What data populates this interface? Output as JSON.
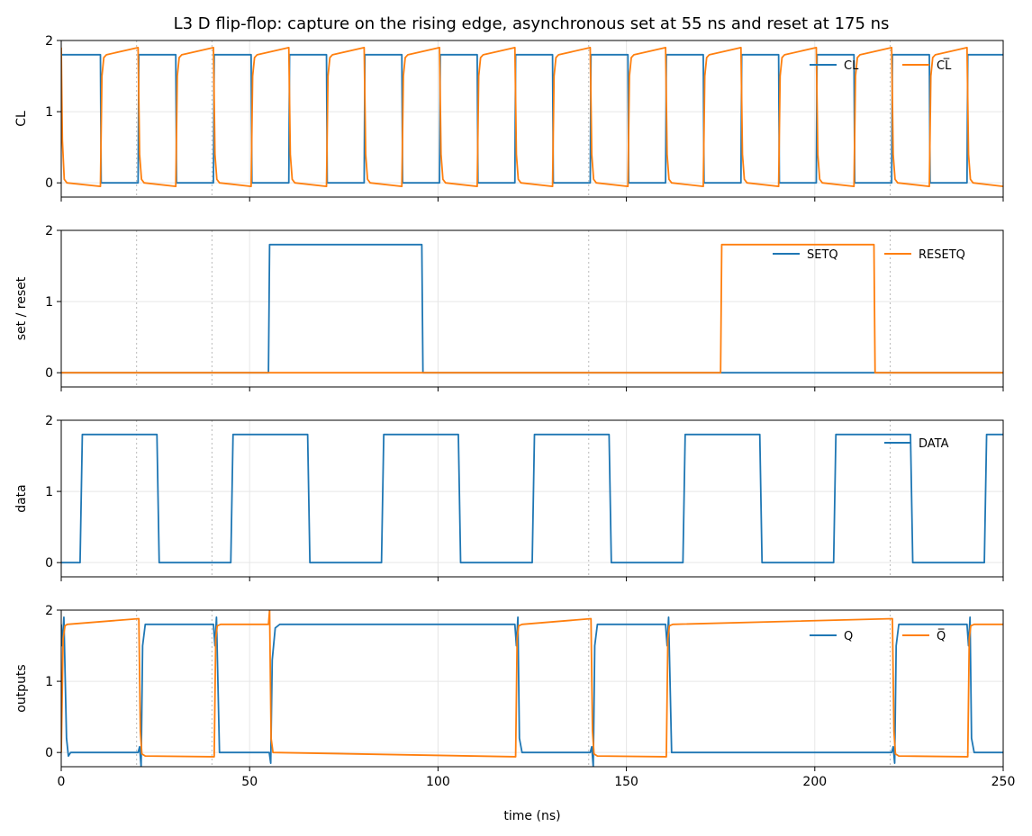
{
  "chart_data": {
    "type": "line",
    "title": "L3  D flip-flop: capture on the rising edge, asynchronous set at 55 ns and reset at 175 ns",
    "xlabel": "time (ns)",
    "xlim": [
      0,
      250
    ],
    "x_ticks": [
      0,
      50,
      100,
      150,
      200,
      250
    ],
    "x_tick_labels": [
      "0",
      "50",
      "100",
      "150",
      "200",
      "250"
    ],
    "dotted_markers_ns": [
      20,
      40,
      140,
      220
    ],
    "colors": {
      "blue": "#1f77b4",
      "orange": "#ff7f0e"
    },
    "panels": [
      {
        "ylabel": "CL",
        "ylim": [
          -0.2,
          2
        ],
        "y_ticks": [
          0,
          1,
          2
        ],
        "y_tick_labels": [
          "0",
          "1",
          "2"
        ],
        "legend_position": "top-right",
        "series": [
          {
            "name": "CL",
            "color": "#1f77b4",
            "x": [
              0,
              0.4,
              10.4,
              10.6,
              20.4,
              20.6,
              30.4,
              30.6,
              40.4,
              40.6,
              50.4,
              50.6,
              60.4,
              60.6,
              70.4,
              70.6,
              80.4,
              80.6,
              90.4,
              90.6,
              100.4,
              100.6,
              110.4,
              110.6,
              120.4,
              120.6,
              130.4,
              130.6,
              140.4,
              140.6,
              150.4,
              150.6,
              160.4,
              160.6,
              170.4,
              170.6,
              180.4,
              180.6,
              190.4,
              190.6,
              200.4,
              200.6,
              210.4,
              210.6,
              220.4,
              220.6,
              230.4,
              230.6,
              240.4,
              240.6,
              250
            ],
            "y": [
              1.8,
              1.8,
              1.8,
              0,
              0,
              1.8,
              1.8,
              0,
              0,
              1.8,
              1.8,
              0,
              0,
              1.8,
              1.8,
              0,
              0,
              1.8,
              1.8,
              0,
              0,
              1.8,
              1.8,
              0,
              0,
              1.8,
              1.8,
              0,
              0,
              1.8,
              1.8,
              0,
              0,
              1.8,
              1.8,
              0,
              0,
              1.8,
              1.8,
              0,
              0,
              1.8,
              1.8,
              0,
              0,
              1.8,
              1.8,
              0,
              0,
              1.8,
              1.8
            ]
          },
          {
            "name": "CL̅",
            "color": "#ff7f0e",
            "x": [
              0,
              0.3,
              0.8,
              1.5,
              10.4,
              10.8,
              11.3,
              12,
              20.4,
              20.8,
              21.3,
              22,
              30.4,
              30.8,
              31.3,
              32,
              40.4,
              40.8,
              41.3,
              42,
              50.4,
              50.8,
              51.3,
              52,
              60.4,
              60.8,
              61.3,
              62,
              70.4,
              70.8,
              71.3,
              72,
              80.4,
              80.8,
              81.3,
              82,
              90.4,
              90.8,
              91.3,
              92,
              100.4,
              100.8,
              101.3,
              102,
              110.4,
              110.8,
              111.3,
              112,
              120.4,
              120.8,
              121.3,
              122,
              130.4,
              130.8,
              131.3,
              132,
              140.4,
              140.8,
              141.3,
              142,
              150.4,
              150.8,
              151.3,
              152,
              160.4,
              160.8,
              161.3,
              162,
              170.4,
              170.8,
              171.3,
              172,
              180.4,
              180.8,
              181.3,
              182,
              190.4,
              190.8,
              191.3,
              192,
              200.4,
              200.8,
              201.3,
              202,
              210.4,
              210.8,
              211.3,
              212,
              220.4,
              220.8,
              221.3,
              222,
              230.4,
              230.8,
              231.3,
              232,
              240.4,
              240.8,
              241.3,
              242,
              250
            ],
            "y": [
              1.9,
              0.6,
              0.05,
              0,
              -0.05,
              1.5,
              1.76,
              1.8,
              1.9,
              0.4,
              0.05,
              0,
              -0.05,
              1.5,
              1.76,
              1.8,
              1.9,
              0.4,
              0.05,
              0,
              -0.05,
              1.5,
              1.76,
              1.8,
              1.9,
              0.4,
              0.05,
              0,
              -0.05,
              1.5,
              1.76,
              1.8,
              1.9,
              0.4,
              0.05,
              0,
              -0.05,
              1.5,
              1.76,
              1.8,
              1.9,
              0.4,
              0.05,
              0,
              -0.05,
              1.5,
              1.76,
              1.8,
              1.9,
              0.4,
              0.05,
              0,
              -0.05,
              1.5,
              1.76,
              1.8,
              1.9,
              0.4,
              0.05,
              0,
              -0.05,
              1.5,
              1.76,
              1.8,
              1.9,
              0.4,
              0.05,
              0,
              -0.05,
              1.5,
              1.76,
              1.8,
              1.9,
              0.4,
              0.05,
              0,
              -0.05,
              1.5,
              1.76,
              1.8,
              1.9,
              0.4,
              0.05,
              0,
              -0.05,
              1.5,
              1.76,
              1.8,
              1.9,
              0.4,
              0.05,
              0,
              -0.05,
              1.5,
              1.76,
              1.8,
              1.9,
              0.4,
              0.05,
              0,
              -0.05,
              1.5,
              1.76,
              1.8,
              1.8
            ]
          }
        ]
      },
      {
        "ylabel": "set / reset",
        "ylim": [
          -0.2,
          2
        ],
        "y_ticks": [
          0,
          1,
          2
        ],
        "y_tick_labels": [
          "0",
          "1",
          "2"
        ],
        "legend_position": "top-right",
        "series": [
          {
            "name": "SETQ",
            "color": "#1f77b4",
            "x": [
              0,
              55,
              55.3,
              95.7,
              96,
              250
            ],
            "y": [
              0,
              0,
              1.8,
              1.8,
              0,
              0
            ]
          },
          {
            "name": "RESETQ",
            "color": "#ff7f0e",
            "x": [
              0,
              175,
              175.3,
              215.7,
              216,
              250
            ],
            "y": [
              0,
              0,
              1.8,
              1.8,
              0,
              0
            ]
          }
        ]
      },
      {
        "ylabel": "data",
        "ylim": [
          -0.2,
          2
        ],
        "y_ticks": [
          0,
          1,
          2
        ],
        "y_tick_labels": [
          "0",
          "1",
          "2"
        ],
        "legend_position": "top-right",
        "series": [
          {
            "name": "DATA",
            "color": "#1f77b4",
            "x": [
              0,
              5,
              5.6,
              25.4,
              26,
              45,
              45.6,
              65.4,
              66,
              85,
              85.6,
              105.4,
              106,
              125,
              125.6,
              145.4,
              146,
              165,
              165.6,
              185.4,
              186,
              205,
              205.6,
              225.4,
              226,
              245,
              245.6,
              250
            ],
            "y": [
              0,
              0,
              1.8,
              1.8,
              0,
              0,
              1.8,
              1.8,
              0,
              0,
              1.8,
              1.8,
              0,
              0,
              1.8,
              1.8,
              0,
              0,
              1.8,
              1.8,
              0,
              0,
              1.8,
              1.8,
              0,
              0,
              1.8,
              1.8
            ]
          }
        ]
      },
      {
        "ylabel": "outputs",
        "ylim": [
          -0.2,
          2
        ],
        "y_ticks": [
          0,
          1,
          2
        ],
        "y_tick_labels": [
          "0",
          "1",
          "2"
        ],
        "legend_position": "top-right",
        "series": [
          {
            "name": "Q",
            "color": "#1f77b4",
            "x": [
              0,
              0.3,
              0.7,
              1.4,
              1.9,
              2.5,
              20.4,
              20.8,
              21.2,
              21.6,
              22.3,
              40.4,
              40.8,
              41.2,
              42,
              55.2,
              55.6,
              56,
              56.8,
              58,
              120.4,
              120.8,
              121.2,
              121.6,
              122.3,
              140.4,
              140.8,
              141.2,
              141.6,
              142.3,
              160.4,
              160.8,
              161.2,
              162,
              220.4,
              220.8,
              221.2,
              221.6,
              222.3,
              240.4,
              240.8,
              241.2,
              241.6,
              242.3,
              250
            ],
            "y": [
              1.8,
              1.5,
              1.9,
              0.2,
              -0.05,
              0,
              0,
              0.08,
              -0.2,
              1.5,
              1.8,
              1.8,
              1.5,
              1.9,
              0,
              0,
              -0.15,
              1.3,
              1.75,
              1.8,
              1.8,
              1.5,
              1.9,
              0.2,
              0,
              0,
              0.08,
              -0.2,
              1.5,
              1.8,
              1.8,
              1.5,
              1.9,
              0,
              0,
              0.08,
              -0.15,
              1.5,
              1.8,
              1.8,
              1.5,
              1.9,
              0.2,
              0,
              0
            ]
          },
          {
            "name": "Q̅",
            "color": "#ff7f0e",
            "x": [
              0,
              0.5,
              1.0,
              1.6,
              20.6,
              21.0,
              21.4,
              22.3,
              40.6,
              41.0,
              41.4,
              42.3,
              55,
              55.3,
              55.7,
              56.2,
              120.6,
              121.0,
              121.4,
              122.3,
              140.6,
              141.0,
              141.4,
              142.3,
              160.6,
              161.0,
              161.4,
              162.3,
              220.6,
              221.0,
              221.4,
              222.3,
              240.6,
              241.0,
              241.4,
              242.3,
              250
            ],
            "y": [
              0,
              1.6,
              1.78,
              1.8,
              1.88,
              0.3,
              -0.02,
              -0.05,
              -0.06,
              1.6,
              1.78,
              1.8,
              1.8,
              2.0,
              0.2,
              0,
              -0.06,
              1.6,
              1.78,
              1.8,
              1.88,
              0.3,
              -0.02,
              -0.05,
              -0.06,
              1.6,
              1.78,
              1.8,
              1.88,
              0.3,
              -0.02,
              -0.05,
              -0.06,
              1.6,
              1.78,
              1.8,
              1.8
            ]
          }
        ]
      }
    ]
  }
}
